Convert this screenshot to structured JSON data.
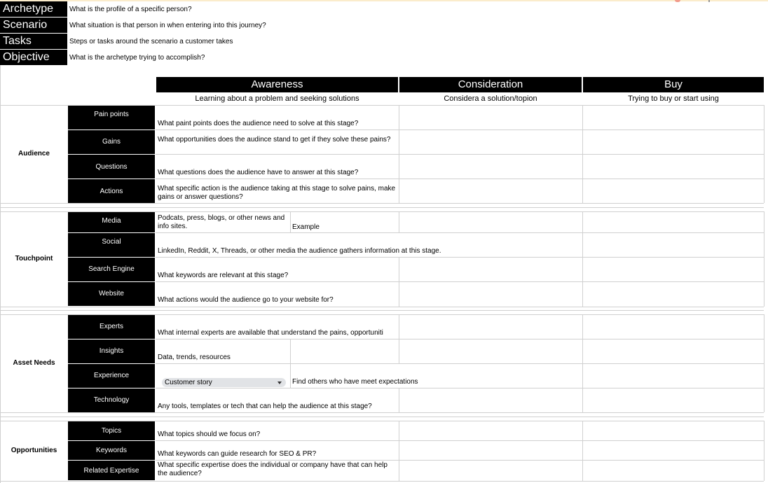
{
  "meta": [
    {
      "label": "Archetype",
      "value": "What is the profile of a specific person?"
    },
    {
      "label": "Scenario",
      "value": "What situation is that person in when entering into this journey?"
    },
    {
      "label": "Tasks",
      "value": "Steps or tasks around the scenario a customer takes"
    },
    {
      "label": "Objective",
      "value": "What is the archetype trying to accomplish?"
    }
  ],
  "stages": [
    {
      "title": "Awareness",
      "subtitle": "Learning about a problem and seeking solutions"
    },
    {
      "title": "Consideration",
      "subtitle": "Considera a solution/topion"
    },
    {
      "title": "Buy",
      "subtitle": "Trying to buy or start using"
    }
  ],
  "sections": {
    "audience": {
      "label": "Audience",
      "rows": [
        {
          "label": "Pain points",
          "text": "What paint points does the audience need to solve at this stage?"
        },
        {
          "label": "Gains",
          "text": "What opportunities does the audince stand to get if they solve these pains?"
        },
        {
          "label": "Questions",
          "text": "What questions does the audience have to answer at this stage?"
        },
        {
          "label": "Actions",
          "text": "What specific action is the audience taking at this stage to solve pains, make gains or answer questions?"
        }
      ]
    },
    "touchpoint": {
      "label": "Touchpoint",
      "rows": [
        {
          "label": "Media",
          "text": "Podcats, press, blogs, or other news and info sites.",
          "text2": "Example"
        },
        {
          "label": "Social",
          "text": "LinkedIn, Reddit, X, Threads, or other media the audience gathers information at this stage."
        },
        {
          "label": "Search Engine",
          "text": "What keywords are relevant at this stage?"
        },
        {
          "label": "Website",
          "text": "What actions would the audience go to your website for?"
        }
      ]
    },
    "asset_needs": {
      "label": "Asset Needs",
      "rows": [
        {
          "label": "Experts",
          "text": "What internal experts are available that understand the pains, opportuniti"
        },
        {
          "label": "Insights",
          "text": "Data, trends, resources"
        },
        {
          "label": "Experience",
          "dropdown_value": "Customer story",
          "text": "Find others who have meet expectations"
        },
        {
          "label": "Technology",
          "text": "Any tools, templates or tech that can help the audience at this stage?"
        }
      ]
    },
    "opportunities": {
      "label": "Opportunities",
      "rows": [
        {
          "label": "Topics",
          "text": "What topics should we focus on?"
        },
        {
          "label": "Keywords",
          "text": "What keywords can guide research for SEO & PR?"
        },
        {
          "label": "Related Expertise",
          "text": "What specific expertise does the individual or company have that can help the audience?"
        }
      ]
    }
  }
}
